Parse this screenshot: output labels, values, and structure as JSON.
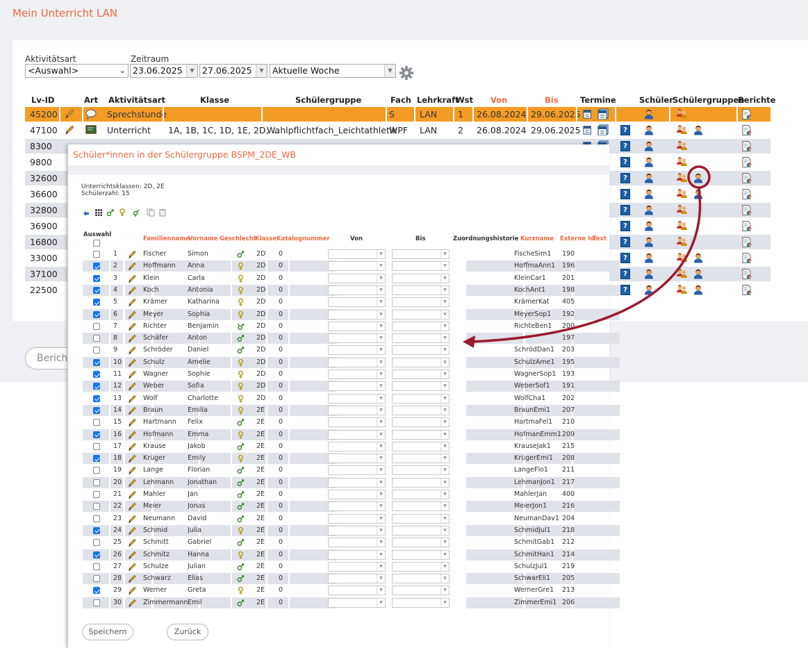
{
  "app_title": "Mein Unterricht LAN",
  "filters": {
    "aktivitaetsart_label": "Aktivitätsart",
    "aktivitaetsart_value": "<Auswahl>",
    "zeitraum_label": "Zeitraum",
    "von_date": "23.06.2025",
    "bis_date": "27.06.2025",
    "period_value": "Aktuelle Woche"
  },
  "main_table": {
    "headers": {
      "lvid": "Lv-ID",
      "art": "Art",
      "aktivitaetsart": "Aktivitätsart",
      "klasse": "Klasse",
      "schuelergruppe": "Schülergruppe",
      "fach": "Fach",
      "lehrkraft": "Lehrkraft",
      "wst": "Wst",
      "von": "Von",
      "bis": "Bis",
      "termine": "Termine",
      "schueler": "Schüler",
      "schuelergruppen": "Schülergruppen",
      "berichte": "Berichte"
    },
    "rows": [
      {
        "lvid": "45200",
        "aktivitaetsart": "Sprechstunde",
        "klasse": "",
        "gruppe": "",
        "fach": "S",
        "lehrkraft": "LAN",
        "wst": "1",
        "von": "26.08.2024",
        "bis": "29.06.2025"
      },
      {
        "lvid": "47100",
        "aktivitaetsart": "Unterricht",
        "klasse": "1A, 1B, 1C, 1D, 1E, 2D, ...",
        "gruppe": "Wahlpflichtfach_Leichtathletik",
        "fach": "WPF",
        "lehrkraft": "LAN",
        "wst": "2",
        "von": "26.08.2024",
        "bis": "29.06.2025"
      },
      {
        "lvid": "8300"
      },
      {
        "lvid": "9800"
      },
      {
        "lvid": "32600"
      },
      {
        "lvid": "36600"
      },
      {
        "lvid": "32800"
      },
      {
        "lvid": "36900"
      },
      {
        "lvid": "16800"
      },
      {
        "lvid": "33000"
      },
      {
        "lvid": "37100"
      },
      {
        "lvid": "22500"
      }
    ]
  },
  "berichte_button": "Berichte",
  "popup": {
    "title": "Schüler*innen in der Schülergruppe BSPM_2DE_WB",
    "unterrichtsklassen": "Unterrichtsklassen: 2D, 2E",
    "schuelerzahl": "Schülerzahl: 15",
    "headers": {
      "auswahl": "Auswahl",
      "familienname": "Familienname",
      "vorname": "Vorname",
      "geschlecht": "Geschlecht",
      "klasse": "Klasse",
      "katalognummer": "Katalognummer",
      "von": "Von",
      "bis": "Bis",
      "zuordnungshistorie": "Zuordnungshistorie",
      "kurzname": "Kurzname",
      "externe_id": "Externe Id",
      "text": "Text"
    },
    "students": [
      {
        "nr": "1",
        "checked": false,
        "familienname": "Fischer",
        "vorname": "Simon",
        "g": "m",
        "klasse": "2D",
        "kat": "0",
        "kurzname": "FischeSim1",
        "extid": "190"
      },
      {
        "nr": "2",
        "checked": true,
        "familienname": "Hoffmann",
        "vorname": "Anna",
        "g": "w",
        "klasse": "2D",
        "kat": "0",
        "kurzname": "HoffmaAnn1",
        "extid": "196"
      },
      {
        "nr": "3",
        "checked": true,
        "familienname": "Klein",
        "vorname": "Carla",
        "g": "w",
        "klasse": "2D",
        "kat": "0",
        "kurzname": "KleinCar1",
        "extid": "201"
      },
      {
        "nr": "4",
        "checked": true,
        "familienname": "Koch",
        "vorname": "Antonia",
        "g": "w",
        "klasse": "2D",
        "kat": "0",
        "kurzname": "KochAnt1",
        "extid": "198"
      },
      {
        "nr": "5",
        "checked": true,
        "familienname": "Krämer",
        "vorname": "Katharina",
        "g": "w",
        "klasse": "2D",
        "kat": "0",
        "kurzname": "KrämerKat",
        "extid": "405"
      },
      {
        "nr": "6",
        "checked": true,
        "familienname": "Meyer",
        "vorname": "Sophia",
        "g": "w",
        "klasse": "2D",
        "kat": "0",
        "kurzname": "MeyerSop1",
        "extid": "192"
      },
      {
        "nr": "7",
        "checked": false,
        "familienname": "Richter",
        "vorname": "Benjamin",
        "g": "d",
        "klasse": "2D",
        "kat": "0",
        "kurzname": "RichteBen1",
        "extid": "200"
      },
      {
        "nr": "8",
        "checked": false,
        "familienname": "Schäfer",
        "vorname": "Anton",
        "g": "m",
        "klasse": "2D",
        "kat": "0",
        "kurzname": "",
        "extid": "197"
      },
      {
        "nr": "9",
        "checked": false,
        "familienname": "Schröder",
        "vorname": "Daniel",
        "g": "m",
        "klasse": "2D",
        "kat": "0",
        "kurzname": "SchrödDan1",
        "extid": "203"
      },
      {
        "nr": "10",
        "checked": true,
        "familienname": "Schulz",
        "vorname": "Amelie",
        "g": "w",
        "klasse": "2D",
        "kat": "0",
        "kurzname": "SchulzAme1",
        "extid": "195"
      },
      {
        "nr": "11",
        "checked": true,
        "familienname": "Wagner",
        "vorname": "Sophie",
        "g": "w",
        "klasse": "2D",
        "kat": "0",
        "kurzname": "WagnerSop1",
        "extid": "193"
      },
      {
        "nr": "12",
        "checked": true,
        "familienname": "Weber",
        "vorname": "Sofia",
        "g": "w",
        "klasse": "2D",
        "kat": "0",
        "kurzname": "WeberSof1",
        "extid": "191"
      },
      {
        "nr": "13",
        "checked": true,
        "familienname": "Wolf",
        "vorname": "Charlotte",
        "g": "w",
        "klasse": "2D",
        "kat": "0",
        "kurzname": "WolfCha1",
        "extid": "202"
      },
      {
        "nr": "14",
        "checked": true,
        "familienname": "Braun",
        "vorname": "Emilia",
        "g": "w",
        "klasse": "2E",
        "kat": "0",
        "kurzname": "BraunEmi1",
        "extid": "207"
      },
      {
        "nr": "15",
        "checked": false,
        "familienname": "Hartmann",
        "vorname": "Felix",
        "g": "m",
        "klasse": "2E",
        "kat": "0",
        "kurzname": "HartmaFel1",
        "extid": "210"
      },
      {
        "nr": "16",
        "checked": true,
        "familienname": "Hofmann",
        "vorname": "Emma",
        "g": "w",
        "klasse": "2E",
        "kat": "0",
        "kurzname": "HofmanEmm1",
        "extid": "209"
      },
      {
        "nr": "17",
        "checked": false,
        "familienname": "Krause",
        "vorname": "Jakob",
        "g": "m",
        "klasse": "2E",
        "kat": "0",
        "kurzname": "KrauseJak1",
        "extid": "215"
      },
      {
        "nr": "18",
        "checked": true,
        "familienname": "Krüger",
        "vorname": "Emily",
        "g": "w",
        "klasse": "2E",
        "kat": "0",
        "kurzname": "KrügerEmi1",
        "extid": "208"
      },
      {
        "nr": "19",
        "checked": false,
        "familienname": "Lange",
        "vorname": "Florian",
        "g": "m",
        "klasse": "2E",
        "kat": "0",
        "kurzname": "LangeFlo1",
        "extid": "211"
      },
      {
        "nr": "20",
        "checked": false,
        "familienname": "Lehmann",
        "vorname": "Jonathan",
        "g": "m",
        "klasse": "2E",
        "kat": "0",
        "kurzname": "LehmanJon1",
        "extid": "217"
      },
      {
        "nr": "21",
        "checked": false,
        "familienname": "Mahler",
        "vorname": "Jan",
        "g": "m",
        "klasse": "2E",
        "kat": "0",
        "kurzname": "MahlerJan",
        "extid": "400"
      },
      {
        "nr": "22",
        "checked": false,
        "familienname": "Meier",
        "vorname": "Jonas",
        "g": "m",
        "klasse": "2E",
        "kat": "0",
        "kurzname": "MeierJon1",
        "extid": "216"
      },
      {
        "nr": "23",
        "checked": false,
        "familienname": "Neumann",
        "vorname": "David",
        "g": "m",
        "klasse": "2E",
        "kat": "0",
        "kurzname": "NeumanDav1",
        "extid": "204"
      },
      {
        "nr": "24",
        "checked": true,
        "familienname": "Schmid",
        "vorname": "Julia",
        "g": "w",
        "klasse": "2E",
        "kat": "0",
        "kurzname": "SchmidJul1",
        "extid": "218"
      },
      {
        "nr": "25",
        "checked": false,
        "familienname": "Schmitt",
        "vorname": "Gabriel",
        "g": "m",
        "klasse": "2E",
        "kat": "0",
        "kurzname": "SchmitGab1",
        "extid": "212"
      },
      {
        "nr": "26",
        "checked": true,
        "familienname": "Schmitz",
        "vorname": "Hanna",
        "g": "w",
        "klasse": "2E",
        "kat": "0",
        "kurzname": "SchmitHan1",
        "extid": "214"
      },
      {
        "nr": "27",
        "checked": false,
        "familienname": "Schulze",
        "vorname": "Julian",
        "g": "m",
        "klasse": "2E",
        "kat": "0",
        "kurzname": "SchulzJul1",
        "extid": "219"
      },
      {
        "nr": "28",
        "checked": false,
        "familienname": "Schwarz",
        "vorname": "Elias",
        "g": "m",
        "klasse": "2E",
        "kat": "0",
        "kurzname": "SchwarEli1",
        "extid": "205"
      },
      {
        "nr": "29",
        "checked": true,
        "familienname": "Werner",
        "vorname": "Greta",
        "g": "w",
        "klasse": "2E",
        "kat": "0",
        "kurzname": "WernerGre1",
        "extid": "213"
      },
      {
        "nr": "30",
        "checked": false,
        "familienname": "Zimmermann",
        "vorname": "Emil",
        "g": "m",
        "klasse": "2E",
        "kat": "0",
        "kurzname": "ZimmerEmi1",
        "extid": "206"
      }
    ],
    "buttons": {
      "save": "Speichern",
      "back": "Zurück"
    }
  },
  "colors": {
    "accent": "#f06a41",
    "highlight_row": "#f39c25",
    "stripe": "#dfe2e8",
    "arrow": "#9b1b30",
    "checkbox": "#1a73e8"
  }
}
